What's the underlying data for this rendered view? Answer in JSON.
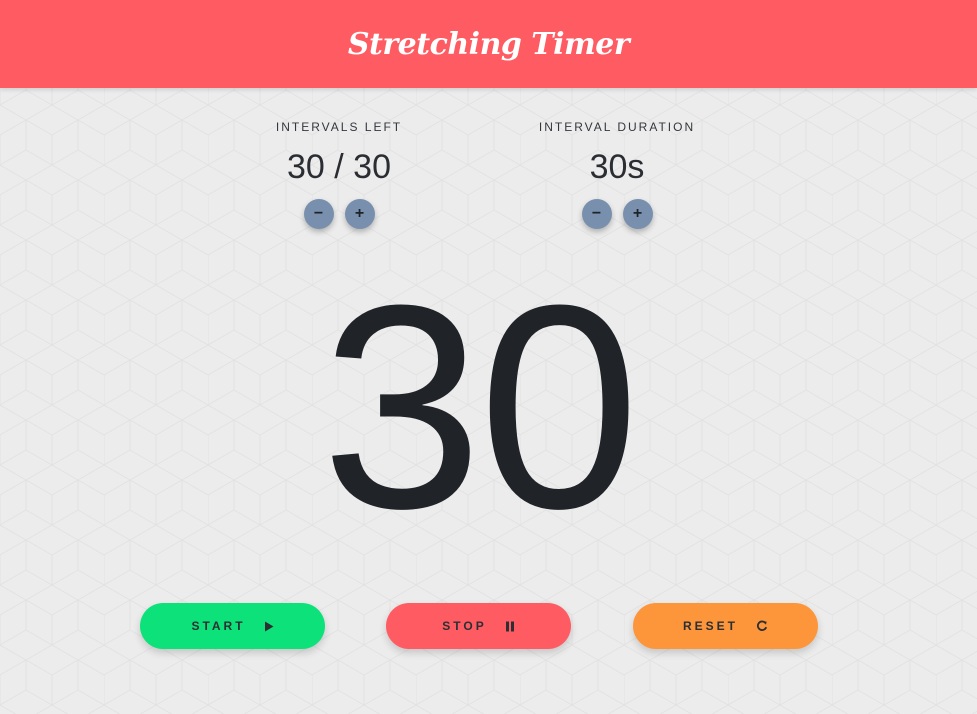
{
  "app": {
    "title": "Stretching Timer"
  },
  "intervals": {
    "label": "INTERVALS LEFT",
    "value": "30 / 30",
    "decrement_label": "−",
    "increment_label": "+"
  },
  "duration": {
    "label": "INTERVAL DURATION",
    "value": "30s",
    "decrement_label": "−",
    "increment_label": "+"
  },
  "countdown": {
    "value": "30"
  },
  "actions": {
    "start_label": "START",
    "start_icon": "play-icon",
    "stop_label": "STOP",
    "stop_icon": "pause-icon",
    "reset_label": "RESET",
    "reset_icon": "refresh-icon"
  },
  "colors": {
    "header": "#fe5c62",
    "start": "#0de27a",
    "stop": "#fe5c62",
    "reset": "#fd963b",
    "stepper": "#7890ad",
    "background": "#ececec"
  }
}
